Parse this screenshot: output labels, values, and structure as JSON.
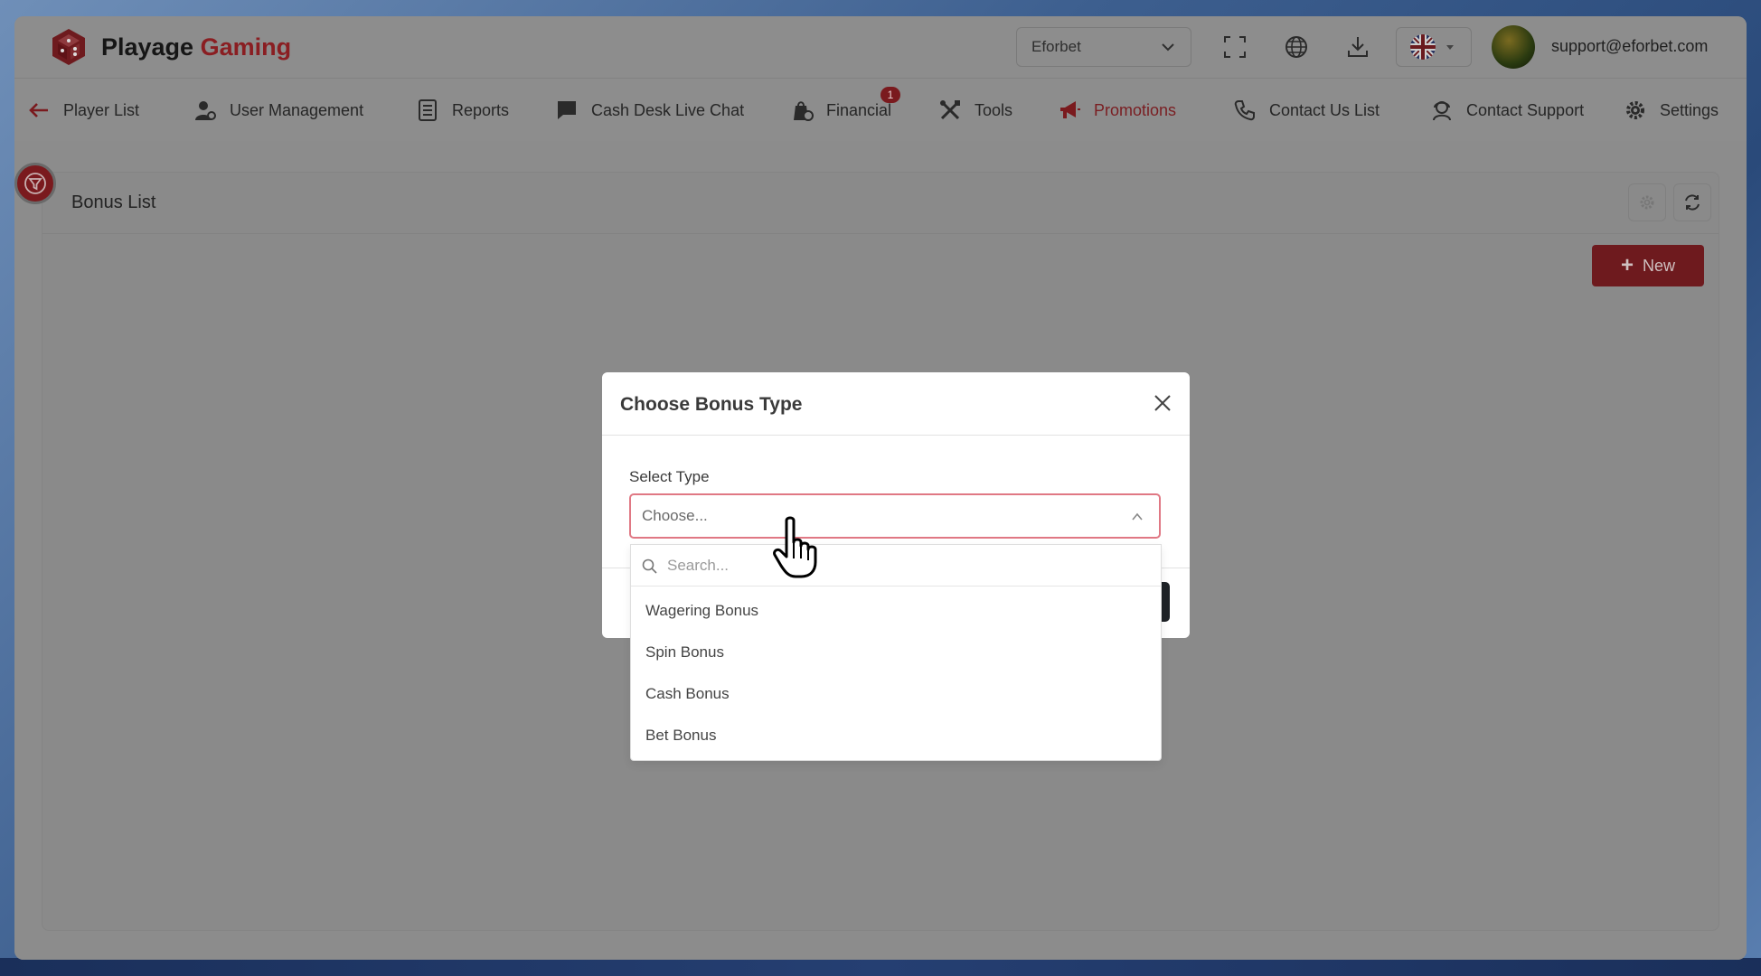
{
  "app": {
    "brand_name": "Playage",
    "brand_accent": "Gaming",
    "brand_color": "#8a1e22"
  },
  "topbar": {
    "brand_select_value": "Eforbet",
    "icons": [
      "fullscreen-icon",
      "globe-icon",
      "download-icon"
    ],
    "language_flag": "uk-flag-icon",
    "user_email": "support@eforbet.com"
  },
  "nav": {
    "back_icon": "arrow-left-icon",
    "items": [
      {
        "label": "Player List",
        "icon": "arrow-left-icon"
      },
      {
        "label": "User Management",
        "icon": "user-gear-icon"
      },
      {
        "label": "Reports",
        "icon": "report-icon"
      },
      {
        "label": "Cash Desk Live Chat",
        "icon": "chat-icon"
      },
      {
        "label": "Financial",
        "icon": "financial-icon",
        "badge": "1"
      },
      {
        "label": "Tools",
        "icon": "tools-icon"
      },
      {
        "label": "Promotions",
        "icon": "megaphone-icon",
        "active": true
      },
      {
        "label": "Contact Us List",
        "icon": "phone-icon"
      },
      {
        "label": "Contact Support",
        "icon": "support-icon"
      },
      {
        "label": "Settings",
        "icon": "gear-icon"
      }
    ]
  },
  "page": {
    "title": "Bonus List",
    "new_button_label": "New"
  },
  "modal": {
    "title": "Choose Bonus Type",
    "field_label": "Select Type",
    "select_placeholder": "Choose...",
    "search_placeholder": "Search...",
    "options": [
      "Wagering Bonus",
      "Spin Bonus",
      "Cash Bonus",
      "Bet Bonus"
    ]
  },
  "colors": {
    "accent": "#7a1a1e",
    "select_border": "#e07884"
  }
}
